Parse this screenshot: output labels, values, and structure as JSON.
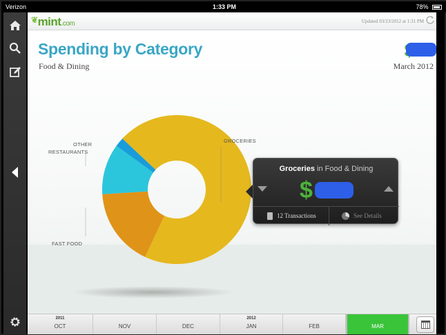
{
  "status_bar": {
    "carrier": "Verizon",
    "time": "1:33 PM",
    "battery": "78%"
  },
  "sidebar": {
    "icons": [
      "home-icon",
      "search-icon",
      "compose-icon",
      "back-arrow-icon",
      "gear-icon"
    ]
  },
  "topbar": {
    "logo": "mint",
    "logo_suffix": ".com",
    "updated": "Updated 03/23/2012 at 1:31 PM"
  },
  "header": {
    "title": "Spending by Category",
    "subtitle": "Food & Dining",
    "total_symbol": "$",
    "month": "March 2012"
  },
  "chart_data": {
    "type": "pie",
    "categories": [
      "Groceries",
      "Fast Food",
      "Restaurants",
      "Other"
    ],
    "labels": [
      "GROCERIES",
      "FAST FOOD",
      "RESTAURANTS",
      "OTHER"
    ],
    "values": [
      70,
      17,
      11,
      2
    ],
    "colors": [
      "#f4c420",
      "#ee9d1b",
      "#2fd3ea",
      "#1aa7e8"
    ]
  },
  "popover": {
    "category": "Groceries",
    "parent_text": "in Food & Dining",
    "amount_symbol": "$",
    "transactions": "12 Transactions",
    "details": "See Details"
  },
  "timeline": {
    "months": [
      {
        "year": "2011",
        "label": "OCT"
      },
      {
        "year": "",
        "label": "NOV"
      },
      {
        "year": "",
        "label": "DEC"
      },
      {
        "year": "2012",
        "label": "JAN"
      },
      {
        "year": "",
        "label": "FEB"
      },
      {
        "year": "",
        "label": "MAR"
      }
    ],
    "active_index": 5,
    "active_color": "#3ac43a"
  }
}
